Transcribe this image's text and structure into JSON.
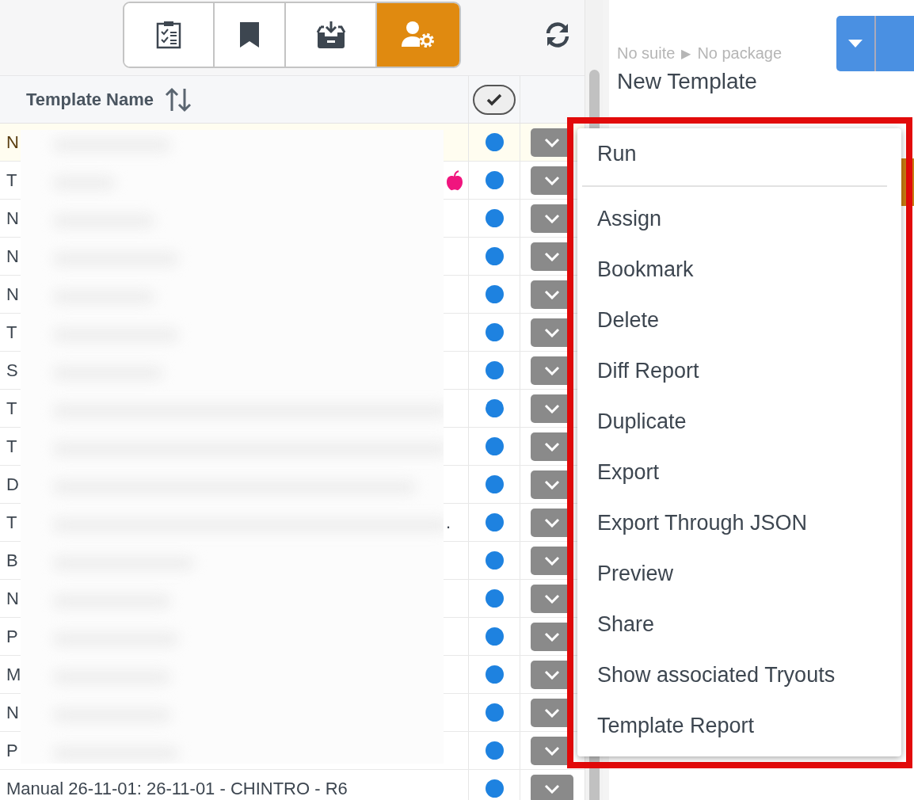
{
  "toolbar": {
    "tabs": [
      {
        "kind": "checklist",
        "selected": false
      },
      {
        "kind": "bookmark",
        "selected": false
      },
      {
        "kind": "inbox",
        "selected": false
      },
      {
        "kind": "user-settings",
        "selected": true
      }
    ]
  },
  "table": {
    "columns": [
      {
        "label": "Template Name",
        "sortable": true
      }
    ],
    "rows": [
      {
        "name": "N",
        "selected": true,
        "tagged": false,
        "color": "#1e82e0"
      },
      {
        "name": "T",
        "selected": false,
        "tagged": true,
        "color": "#1e82e0"
      },
      {
        "name": "N",
        "selected": false,
        "tagged": false,
        "color": "#1e82e0"
      },
      {
        "name": "N",
        "selected": false,
        "tagged": false,
        "color": "#1e82e0"
      },
      {
        "name": "N",
        "selected": false,
        "tagged": false,
        "color": "#1e82e0"
      },
      {
        "name": "T",
        "selected": false,
        "tagged": false,
        "color": "#1e82e0"
      },
      {
        "name": "S",
        "selected": false,
        "tagged": false,
        "color": "#1e82e0"
      },
      {
        "name": "T",
        "selected": false,
        "tagged": false,
        "color": "#1e82e0"
      },
      {
        "name": "T",
        "selected": false,
        "tagged": false,
        "color": "#1e82e0"
      },
      {
        "name": "D",
        "selected": false,
        "tagged": false,
        "color": "#1e82e0"
      },
      {
        "name": "T",
        "suffix": ".",
        "selected": false,
        "tagged": false,
        "color": "#1e82e0"
      },
      {
        "name": "B",
        "selected": false,
        "tagged": false,
        "color": "#1e82e0"
      },
      {
        "name": "N",
        "selected": false,
        "tagged": false,
        "color": "#1e82e0"
      },
      {
        "name": "P",
        "selected": false,
        "tagged": false,
        "color": "#1e82e0"
      },
      {
        "name": "M",
        "selected": false,
        "tagged": false,
        "color": "#1e82e0"
      },
      {
        "name": "N",
        "selected": false,
        "tagged": false,
        "color": "#1e82e0"
      },
      {
        "name": "P",
        "selected": false,
        "tagged": false,
        "color": "#1e82e0"
      },
      {
        "name": "Manual 26-11-01: 26-11-01 - CHINTRO - R6",
        "selected": false,
        "tagged": false,
        "color": "#1e82e0"
      }
    ]
  },
  "details": {
    "suite": "No suite",
    "separator": "▶",
    "package": "No package",
    "title": "New Template"
  },
  "menu": {
    "items": [
      {
        "kind": "action",
        "label": "Run"
      },
      {
        "kind": "divider"
      },
      {
        "kind": "action",
        "label": "Assign"
      },
      {
        "kind": "action",
        "label": "Bookmark"
      },
      {
        "kind": "action",
        "label": "Delete"
      },
      {
        "kind": "action",
        "label": "Diff Report"
      },
      {
        "kind": "action",
        "label": "Duplicate"
      },
      {
        "kind": "action",
        "label": "Export"
      },
      {
        "kind": "action",
        "label": "Export Through JSON"
      },
      {
        "kind": "action",
        "label": "Preview"
      },
      {
        "kind": "action",
        "label": "Share"
      },
      {
        "kind": "action",
        "label": "Show associated Tryouts"
      },
      {
        "kind": "action",
        "label": "Template Report"
      }
    ]
  }
}
